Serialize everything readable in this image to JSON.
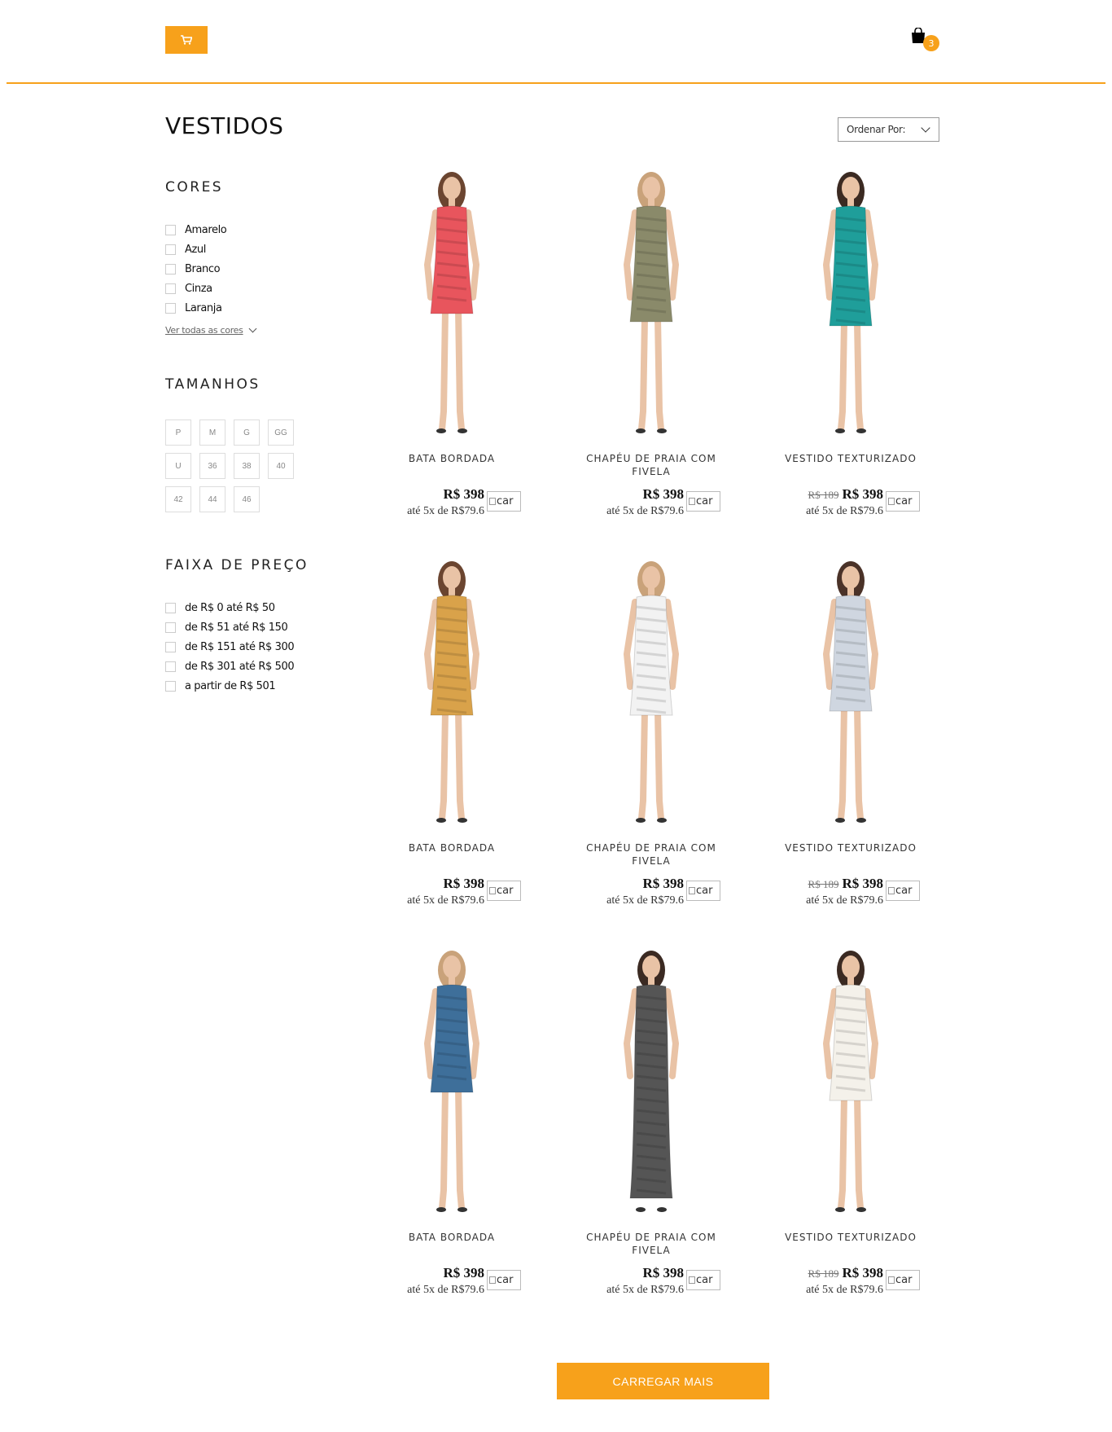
{
  "header": {
    "cart_icon": "shopping-cart-icon",
    "bag_icon": "shopping-bag-icon",
    "bag_count": "3",
    "accent": "#F7A11B"
  },
  "page": {
    "title": "VESTIDOS",
    "sort_label": "Ordenar Por:"
  },
  "filters": {
    "colors_heading": "CORES",
    "colors": [
      "Amarelo",
      "Azul",
      "Branco",
      "Cinza",
      "Laranja"
    ],
    "see_all_colors": "Ver todas as cores",
    "sizes_heading": "TAMANHOS",
    "sizes": [
      "P",
      "M",
      "G",
      "GG",
      "U",
      "36",
      "38",
      "40",
      "42",
      "44",
      "46"
    ],
    "price_heading": "FAIXA DE PREÇO",
    "price_ranges": [
      "de R$ 0 até R$ 50",
      "de R$ 51 até R$ 150",
      "de R$ 151 até R$ 300",
      "de R$ 301 até R$ 500",
      "a partir de R$ 501"
    ]
  },
  "products": [
    {
      "name": "BATA BORDADA",
      "old_price": "",
      "price": "R$ 398",
      "installment": "até 5x de R$79.6",
      "img_alt": "car"
    },
    {
      "name": "CHAPÉU DE PRAIA COM FIVELA",
      "old_price": "",
      "price": "R$ 398",
      "installment": "até 5x de R$79.6",
      "img_alt": "car"
    },
    {
      "name": "VESTIDO TEXTURIZADO",
      "old_price": "R$ 189",
      "price": "R$ 398",
      "installment": "até 5x de R$79.6",
      "img_alt": "car"
    },
    {
      "name": "BATA BORDADA",
      "old_price": "",
      "price": "R$ 398",
      "installment": "até 5x de R$79.6",
      "img_alt": "car"
    },
    {
      "name": "CHAPÉU DE PRAIA COM FIVELA",
      "old_price": "",
      "price": "R$ 398",
      "installment": "até 5x de R$79.6",
      "img_alt": "car"
    },
    {
      "name": "VESTIDO TEXTURIZADO",
      "old_price": "R$ 189",
      "price": "R$ 398",
      "installment": "até 5x de R$79.6",
      "img_alt": "car"
    },
    {
      "name": "BATA BORDADA",
      "old_price": "",
      "price": "R$ 398",
      "installment": "até 5x de R$79.6",
      "img_alt": "car"
    },
    {
      "name": "CHAPÉU DE PRAIA COM FIVELA",
      "old_price": "",
      "price": "R$ 398",
      "installment": "até 5x de R$79.6",
      "img_alt": "car"
    },
    {
      "name": "VESTIDO TEXTURIZADO",
      "old_price": "R$ 189",
      "price": "R$ 398",
      "installment": "até 5x de R$79.6",
      "img_alt": "car"
    }
  ],
  "product_dress_colors": [
    "#e8555d",
    "#8a8a6a",
    "#1f9e9a",
    "#d9a24a",
    "#f2f2f2",
    "#cfd6e0",
    "#3e6f9a",
    "#555555",
    "#f4f1ea"
  ],
  "load_more_label": "CARREGAR MAIS"
}
